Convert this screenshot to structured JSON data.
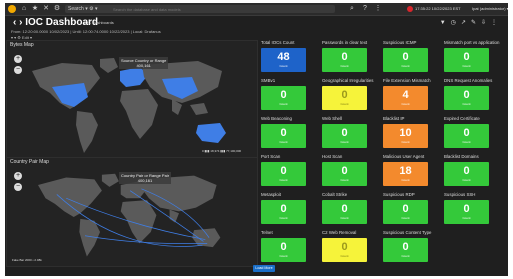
{
  "navbar": {
    "search_label": "Search ▾  ⚙ ▾",
    "search_placeholder": "Search the database and data models",
    "datetime": "17:35:22 10/22/2023 EST",
    "user": "Ipat (administrator) ▾"
  },
  "header": {
    "title": "IOC Dashboard",
    "title_chip": "IOC Dashboards",
    "range": "From: 12:20:00.0000 10/02/2023 | Until: 12:00:74.0000 10/22/2023 | Local: Drafanus",
    "vars": "▾ ▾  ⚙ Edit ▾"
  },
  "panels": {
    "bytes_map": {
      "title": "Bytes Map",
      "tooltip": "Source Country or Range",
      "tooltip_value": "400,161",
      "legend": "0 ▮▮▮ 18,374 ▮▮▮ 77,100,000"
    },
    "country_pair_map": {
      "title": "Country Pair Map",
      "tooltip": "Country Pair or Range Pair",
      "tooltip_value": "400,161",
      "legend": "Fake Bar 2000 • 2.08k"
    }
  },
  "stats": [
    {
      "title": "Total IOCs Count",
      "value": "48",
      "caption": "Count",
      "color": "#1e63c9"
    },
    {
      "title": "Passwords in clear text",
      "value": "0",
      "caption": "Count",
      "color": "#34c93a"
    },
    {
      "title": "Suspicious ICMP",
      "value": "0",
      "caption": "Count",
      "color": "#34c93a"
    },
    {
      "title": "Mismatch port vs application",
      "value": "0",
      "caption": "Count",
      "color": "#34c93a"
    },
    {
      "title": "SMBv1",
      "value": "0",
      "caption": "Count",
      "color": "#34c93a"
    },
    {
      "title": "Geographical Irregularities",
      "value": "0",
      "caption": "Count",
      "color": "#f6f33a"
    },
    {
      "title": "File Extension Mismatch",
      "value": "4",
      "caption": "Count",
      "color": "#f38a2d"
    },
    {
      "title": "DNS Request Anomalies",
      "value": "0",
      "caption": "Count",
      "color": "#34c93a"
    },
    {
      "title": "Web Beaconing",
      "value": "0",
      "caption": "Count",
      "color": "#34c93a"
    },
    {
      "title": "Web Shell",
      "value": "0",
      "caption": "Count",
      "color": "#34c93a"
    },
    {
      "title": "Blacklist IP",
      "value": "10",
      "caption": "Count",
      "color": "#f38a2d"
    },
    {
      "title": "Expired Certificate",
      "value": "0",
      "caption": "Count",
      "color": "#34c93a"
    },
    {
      "title": "Port Scan",
      "value": "0",
      "caption": "Count",
      "color": "#34c93a"
    },
    {
      "title": "Host Scan",
      "value": "0",
      "caption": "Count",
      "color": "#34c93a"
    },
    {
      "title": "Malicious User Agent",
      "value": "18",
      "caption": "Count",
      "color": "#f38a2d"
    },
    {
      "title": "Blacklist Domains",
      "value": "0",
      "caption": "Count",
      "color": "#34c93a"
    },
    {
      "title": "Metasploit",
      "value": "0",
      "caption": "Count",
      "color": "#34c93a"
    },
    {
      "title": "Cobalt Strike",
      "value": "0",
      "caption": "Count",
      "color": "#34c93a"
    },
    {
      "title": "Suspicious RDP",
      "value": "0",
      "caption": "Count",
      "color": "#34c93a"
    },
    {
      "title": "Suspicious SSH",
      "value": "0",
      "caption": "Count",
      "color": "#34c93a"
    },
    {
      "title": "Telnet",
      "value": "0",
      "caption": "Count",
      "color": "#34c93a"
    },
    {
      "title": "C2 Web Removal",
      "value": "0",
      "caption": "Count",
      "color": "#f6f33a"
    },
    {
      "title": "Suspicious Content Type",
      "value": "0",
      "caption": "Count",
      "color": "#34c93a"
    }
  ],
  "load_more": "Load More"
}
